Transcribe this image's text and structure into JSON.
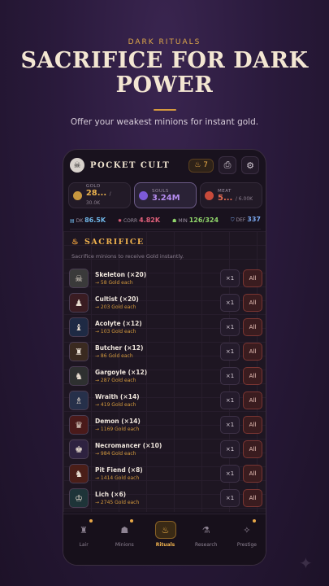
{
  "hero": {
    "kicker": "DARK RITUALS",
    "headline_line1": "SACRIFICE FOR DARK",
    "headline_line2": "POWER",
    "tagline": "Offer your weakest minions for instant gold."
  },
  "app": {
    "title": "POCKET CULT",
    "flame_count": "7",
    "resources": [
      {
        "label": "GOLD",
        "value": "28...",
        "cap": "/ 30.0K",
        "color": "#e8b04d"
      },
      {
        "label": "SOULS",
        "value": "3.24M",
        "cap": "",
        "color": "#b58cf0"
      },
      {
        "label": "MEAT",
        "value": "5...",
        "cap": "/ 6.00K",
        "color": "#e46b52"
      }
    ],
    "stats": [
      {
        "label": "DK",
        "value": "86.5K",
        "color": "#6fb6e8"
      },
      {
        "label": "CORR",
        "value": "4.82K",
        "color": "#e0607a"
      },
      {
        "label": "MIN",
        "value": "126/324",
        "color": "#8fd46a"
      },
      {
        "label": "DEF",
        "value": "337",
        "color": "#7aa8f0"
      }
    ]
  },
  "sacrifice": {
    "title": "SACRIFICE",
    "subtitle": "Sacrifice minions to receive Gold instantly.",
    "button_one": "×1",
    "button_all": "All",
    "minions": [
      {
        "name": "Skeleton (×20)",
        "gold": "→ 58 Gold each",
        "icon": "skull-icon",
        "glyph": "☠",
        "tint": "#3a3a3a"
      },
      {
        "name": "Cultist (×20)",
        "gold": "→ 203 Gold each",
        "icon": "cultist-icon",
        "glyph": "♟",
        "tint": "#3a1c22"
      },
      {
        "name": "Acolyte (×12)",
        "gold": "→ 103 Gold each",
        "icon": "acolyte-icon",
        "glyph": "♝",
        "tint": "#1e2a44"
      },
      {
        "name": "Butcher (×12)",
        "gold": "→ 86 Gold each",
        "icon": "butcher-icon",
        "glyph": "♜",
        "tint": "#3a2a20"
      },
      {
        "name": "Gargoyle (×12)",
        "gold": "→ 287 Gold each",
        "icon": "gargoyle-icon",
        "glyph": "♞",
        "tint": "#2e3030"
      },
      {
        "name": "Wraith (×14)",
        "gold": "→ 419 Gold each",
        "icon": "wraith-icon",
        "glyph": "♗",
        "tint": "#26304a"
      },
      {
        "name": "Demon (×14)",
        "gold": "→ 1169 Gold each",
        "icon": "demon-icon",
        "glyph": "♛",
        "tint": "#4a1a1a"
      },
      {
        "name": "Necromancer (×10)",
        "gold": "→ 984 Gold each",
        "icon": "necromancer-icon",
        "glyph": "♚",
        "tint": "#2e2240"
      },
      {
        "name": "Pit Fiend (×8)",
        "gold": "→ 1414 Gold each",
        "icon": "pit-fiend-icon",
        "glyph": "♞",
        "tint": "#4a1e18"
      },
      {
        "name": "Lich (×6)",
        "gold": "→ 2745 Gold each",
        "icon": "lich-icon",
        "glyph": "♔",
        "tint": "#1e3438"
      }
    ]
  },
  "nav": [
    {
      "label": "Lair",
      "glyph": "♜",
      "icon": "lair-icon",
      "dot": true,
      "active": false
    },
    {
      "label": "Minions",
      "glyph": "☗",
      "icon": "minions-icon",
      "dot": true,
      "active": false
    },
    {
      "label": "Rituals",
      "glyph": "♨",
      "icon": "flame-icon",
      "dot": false,
      "active": true
    },
    {
      "label": "Research",
      "glyph": "⚗",
      "icon": "flask-icon",
      "dot": false,
      "active": false
    },
    {
      "label": "Prestige",
      "glyph": "✧",
      "icon": "sparkle-icon",
      "dot": true,
      "active": false
    }
  ]
}
